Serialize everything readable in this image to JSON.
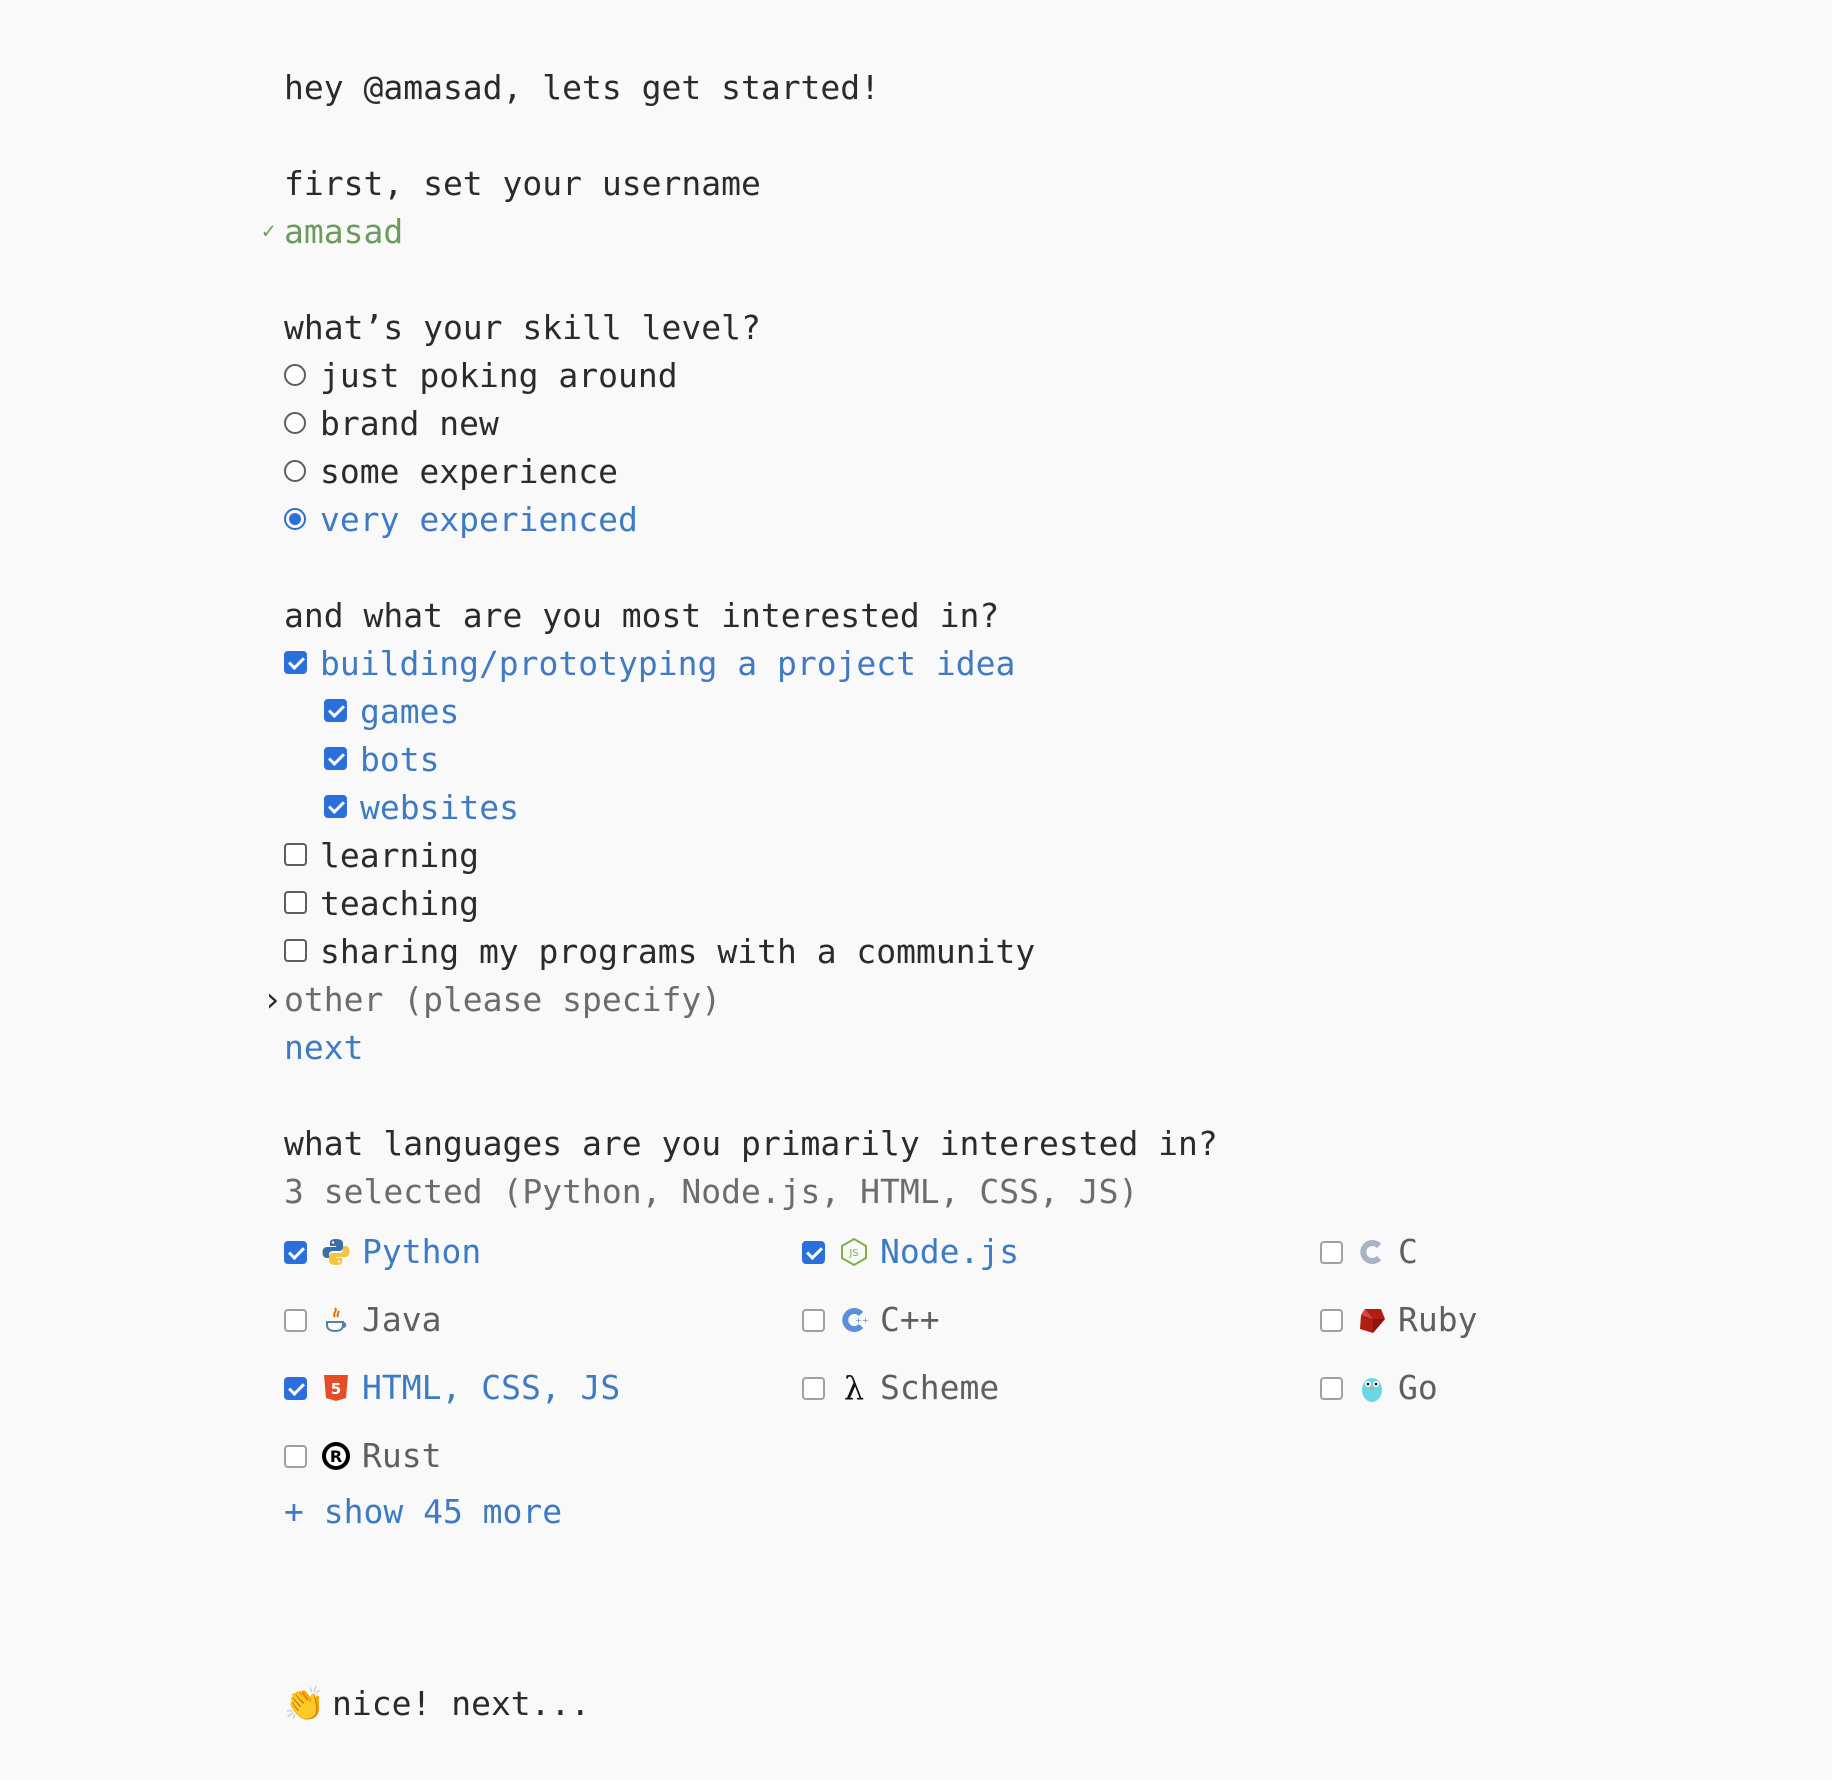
{
  "greeting": "hey @amasad, lets get started!",
  "username_prompt": "first, set your username",
  "username_value": "amasad",
  "skill": {
    "question": "what’s your skill level?",
    "options": [
      {
        "label": "just poking around",
        "selected": false
      },
      {
        "label": "brand new",
        "selected": false
      },
      {
        "label": "some experience",
        "selected": false
      },
      {
        "label": "very experienced",
        "selected": true
      }
    ]
  },
  "interests": {
    "question": "and what are you most interested in?",
    "items": [
      {
        "label": "building/prototyping a project idea",
        "checked": true
      },
      {
        "label": "games",
        "checked": true
      },
      {
        "label": "bots",
        "checked": true
      },
      {
        "label": "websites",
        "checked": true
      },
      {
        "label": "learning",
        "checked": false
      },
      {
        "label": "teaching",
        "checked": false
      },
      {
        "label": "sharing my programs with a community",
        "checked": false
      }
    ],
    "other_placeholder": "other (please specify)",
    "next_label": "next"
  },
  "languages": {
    "question": "what languages are you primarily interested in?",
    "selected_summary": "3 selected (Python, Node.js, HTML, CSS, JS)",
    "items": [
      {
        "label": "Python",
        "checked": true,
        "icon": "python-icon"
      },
      {
        "label": "Node.js",
        "checked": true,
        "icon": "nodejs-icon"
      },
      {
        "label": "C",
        "checked": false,
        "icon": "c-icon"
      },
      {
        "label": "Java",
        "checked": false,
        "icon": "java-icon"
      },
      {
        "label": "C++",
        "checked": false,
        "icon": "cpp-icon"
      },
      {
        "label": "Ruby",
        "checked": false,
        "icon": "ruby-icon"
      },
      {
        "label": "HTML, CSS, JS",
        "checked": true,
        "icon": "html5-icon"
      },
      {
        "label": "Scheme",
        "checked": false,
        "icon": "lambda-icon"
      },
      {
        "label": "Go",
        "checked": false,
        "icon": "gopher-icon"
      },
      {
        "label": "Rust",
        "checked": false,
        "icon": "rust-icon"
      }
    ],
    "show_more_label": "+ show 45 more"
  },
  "footer": {
    "icon": "clapping-hands-icon",
    "text": "nice! next..."
  },
  "colors": {
    "accent": "#3d7bc4",
    "checkbox_blue": "#2a6fdb",
    "success_green": "#6a9c5c",
    "background": "#f9f9f9"
  }
}
